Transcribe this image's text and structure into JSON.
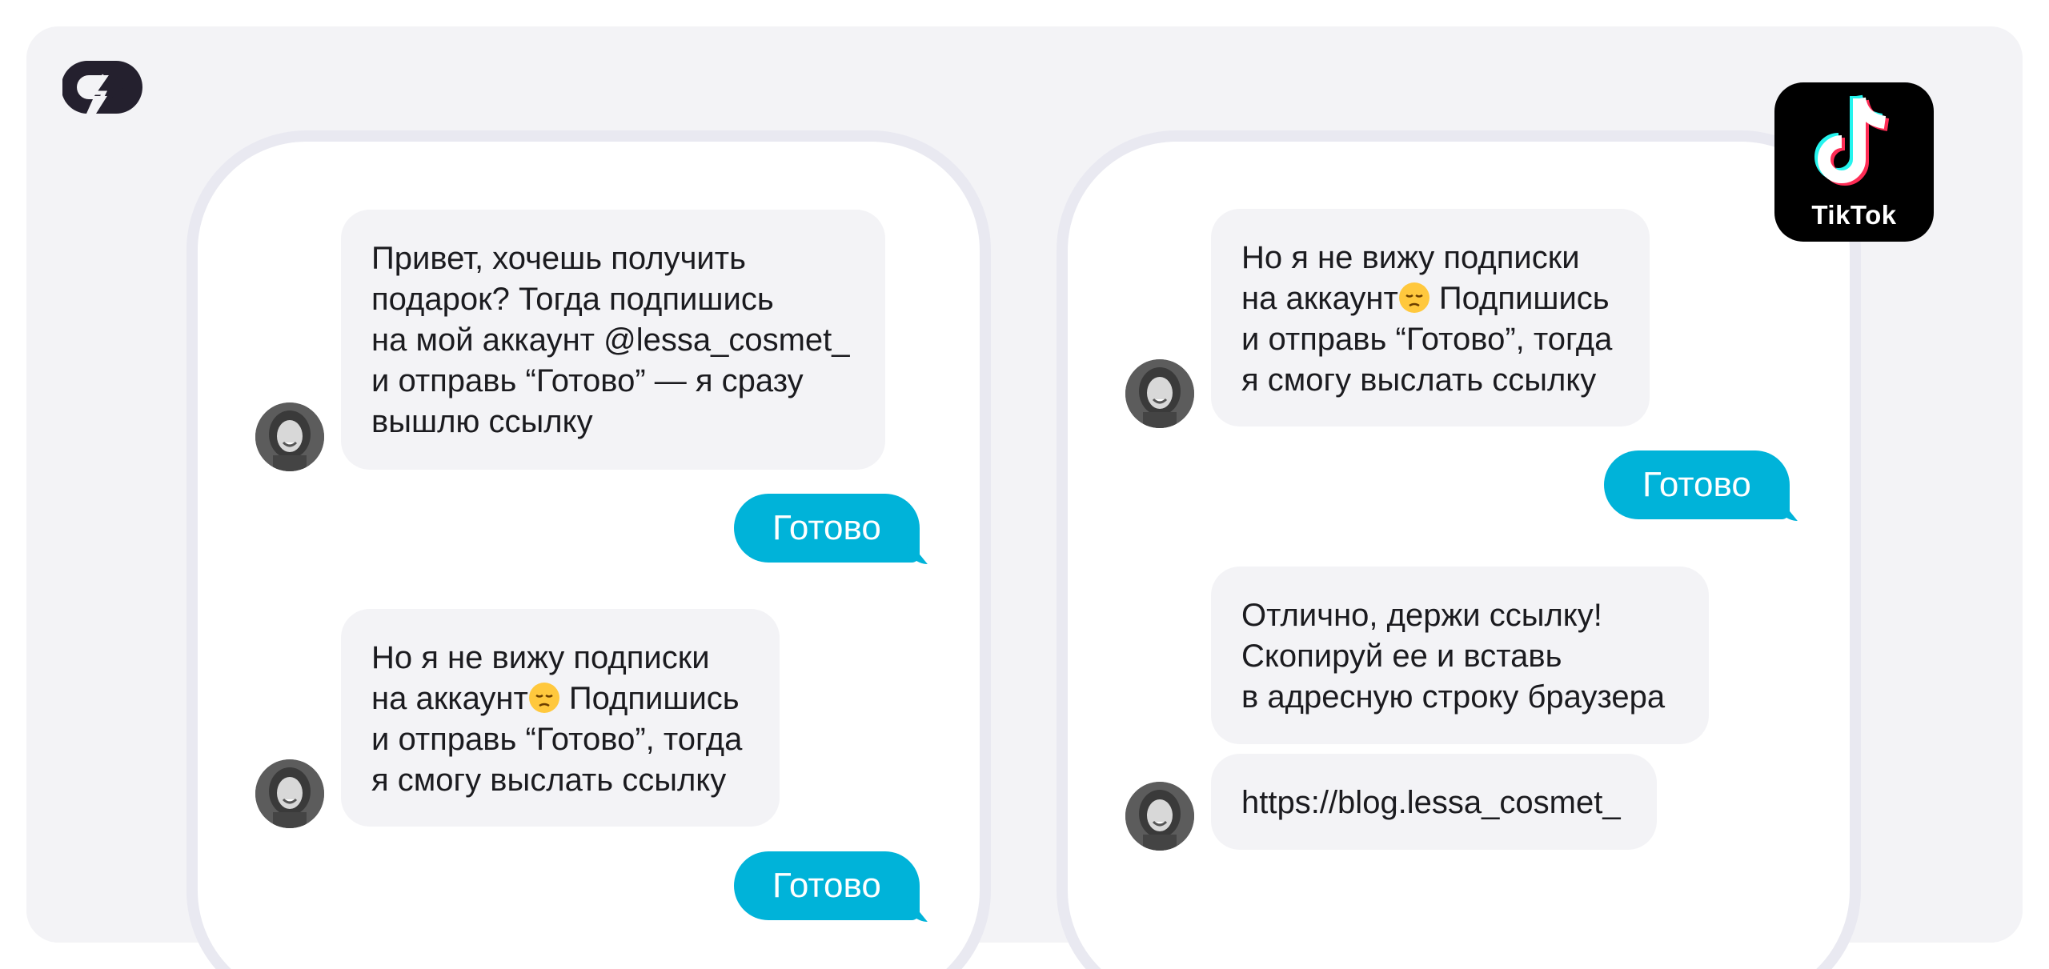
{
  "brand": {
    "icon": "bolt-logo-icon"
  },
  "tiktok": {
    "label": "TikTok",
    "icon": "tiktok-note-icon"
  },
  "colors": {
    "panel": "#f3f3f6",
    "phone_frame": "#e9e9f1",
    "incoming_bubble": "#f3f3f6",
    "outgoing_bubble": "#00b3d9",
    "text": "#1b1b1f"
  },
  "left_chat": {
    "messages": [
      {
        "from": "bot",
        "text": "Привет, хочешь получить\nподарок? Тогда подпишись\nна мой аккаунт @lessa_cosmet_\nи отправь “Готово” — я сразу\nвышлю ссылку"
      },
      {
        "from": "user",
        "text": "Готово"
      },
      {
        "from": "bot",
        "line1": "Но я не вижу подписки",
        "line2a": "на аккаунт",
        "emoji": "pensive-face",
        "line2b": " Подпишись",
        "line3": "и отправь “Готово”, тогда",
        "line4": "я смогу выслать ссылку"
      },
      {
        "from": "user",
        "text": "Готово"
      }
    ]
  },
  "right_chat": {
    "messages": [
      {
        "from": "bot",
        "line1": "Но я не вижу подписки",
        "line2a": "на аккаунт",
        "emoji": "pensive-face",
        "line2b": " Подпишись",
        "line3": "и отправь “Готово”, тогда",
        "line4": "я смогу выслать ссылку"
      },
      {
        "from": "user",
        "text": "Готово"
      },
      {
        "from": "bot",
        "text": "Отлично, держи ссылку!\nСкопируй ее и вставь\nв адресную строку браузера"
      },
      {
        "from": "bot",
        "text": "https://blog.lessa_cosmet_"
      }
    ]
  }
}
